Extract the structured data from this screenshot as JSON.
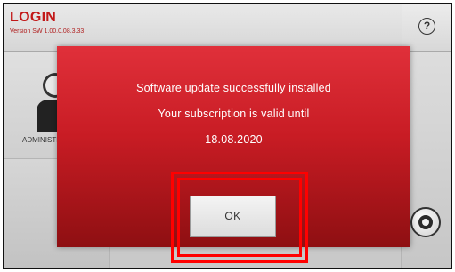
{
  "background": {
    "title": "LOGIN",
    "version": "Version SW 1.00.0.08.3.33",
    "user_label": "ADMINISTRATOR",
    "help_icon_glyph": "?",
    "icons": [
      "help-icon",
      "user-icon",
      "power-icon"
    ]
  },
  "dialog": {
    "line1": "Software update successfully installed",
    "line2": "Your subscription is valid until",
    "line3": "18.08.2020",
    "ok_label": "OK"
  },
  "colors": {
    "dialog_top": "#e0303a",
    "dialog_bottom": "#8e0f12",
    "highlight": "#ff0000"
  }
}
